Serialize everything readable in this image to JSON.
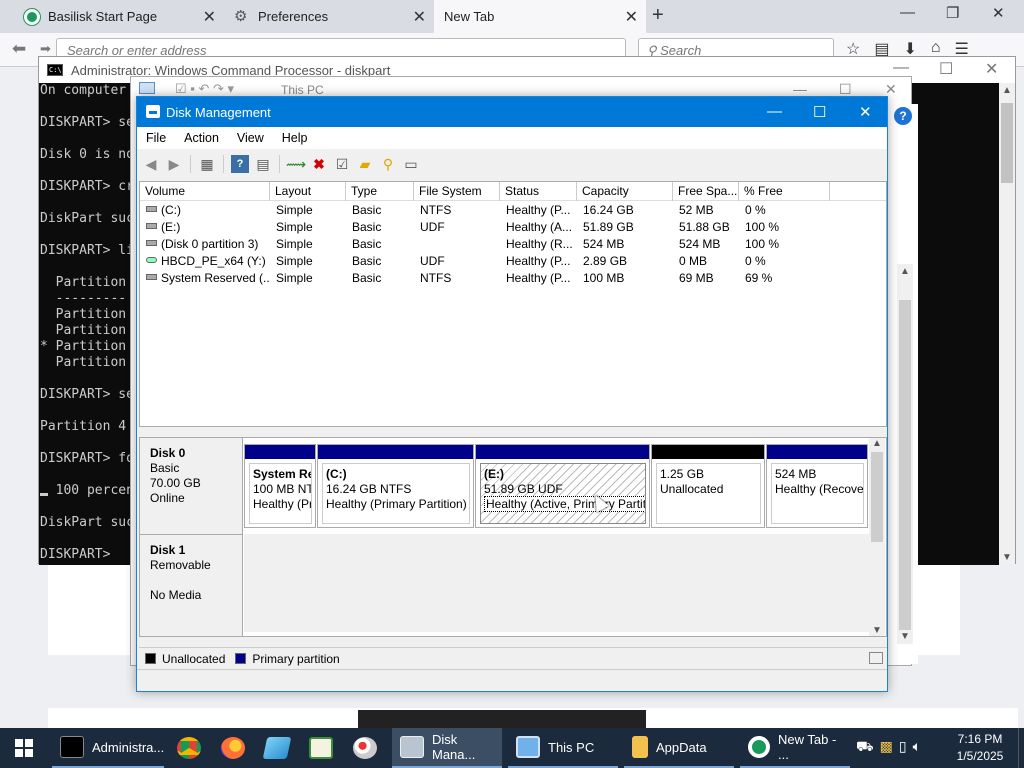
{
  "browser": {
    "tabs": [
      {
        "label": "Basilisk Start Page",
        "icon": "basilisk-icon",
        "active": false
      },
      {
        "label": "Preferences",
        "icon": "gear-icon",
        "active": false
      },
      {
        "label": "New Tab",
        "icon": "",
        "active": true
      }
    ],
    "url_placeholder": "Search or enter address",
    "search_placeholder": "Search"
  },
  "cmd": {
    "title": "Administrator: Windows Command Processor - diskpart",
    "lines": [
      "On computer",
      "",
      "DISKPART> se",
      "",
      "Disk 0 is no",
      "",
      "DISKPART> cr",
      "",
      "DiskPart suc",
      "",
      "DISKPART> li",
      "",
      "  Partition",
      "  ---------",
      "  Partition",
      "  Partition",
      "* Partition",
      "  Partition",
      "",
      "DISKPART> se",
      "",
      "Partition 4",
      "",
      "DISKPART> fo",
      "",
      "  100 percen",
      "",
      "DiskPart suc",
      "",
      "DISKPART>"
    ]
  },
  "thispc": {
    "title": "This PC"
  },
  "dm": {
    "title": "Disk Management",
    "menu": [
      "File",
      "Action",
      "View",
      "Help"
    ],
    "columns": [
      "Volume",
      "Layout",
      "Type",
      "File System",
      "Status",
      "Capacity",
      "Free Spa...",
      "% Free"
    ],
    "volumes": [
      {
        "volume": "(C:)",
        "layout": "Simple",
        "type": "Basic",
        "fs": "NTFS",
        "status": "Healthy (P...",
        "capacity": "16.24 GB",
        "free": "52 MB",
        "pct": "0 %"
      },
      {
        "volume": "(E:)",
        "layout": "Simple",
        "type": "Basic",
        "fs": "UDF",
        "status": "Healthy (A...",
        "capacity": "51.89 GB",
        "free": "51.88 GB",
        "pct": "100 %"
      },
      {
        "volume": "(Disk 0 partition 3)",
        "layout": "Simple",
        "type": "Basic",
        "fs": "",
        "status": "Healthy (R...",
        "capacity": "524 MB",
        "free": "524 MB",
        "pct": "100 %"
      },
      {
        "volume": "HBCD_PE_x64 (Y:)",
        "layout": "Simple",
        "type": "Basic",
        "fs": "UDF",
        "status": "Healthy (P...",
        "capacity": "2.89 GB",
        "free": "0 MB",
        "pct": "0 %"
      },
      {
        "volume": "System Reserved (...",
        "layout": "Simple",
        "type": "Basic",
        "fs": "NTFS",
        "status": "Healthy (P...",
        "capacity": "100 MB",
        "free": "69 MB",
        "pct": "69 %"
      }
    ],
    "disk0": {
      "name": "Disk 0",
      "type": "Basic",
      "size": "70.00 GB",
      "state": "Online"
    },
    "disk0_parts": [
      {
        "title": "System Re",
        "line1": "100 MB NT",
        "line2": "Healthy (Pr",
        "bar": "primary"
      },
      {
        "title": "(C:)",
        "line1": "16.24 GB NTFS",
        "line2": "Healthy (Primary Partition)",
        "bar": "primary"
      },
      {
        "title": "(E:)",
        "line1": "51.89 GB UDF",
        "line2": "Healthy (Active, Primary Partition)",
        "bar": "primary"
      },
      {
        "title": "",
        "line1": "1.25 GB",
        "line2": "Unallocated",
        "bar": "unallocated"
      },
      {
        "title": "",
        "line1": "524 MB",
        "line2": "Healthy (Recove",
        "bar": "primary"
      }
    ],
    "disk1": {
      "name": "Disk 1",
      "type": "Removable",
      "state": "No Media"
    },
    "legend": {
      "unallocated": "Unallocated",
      "primary": "Primary partition"
    },
    "colors": {
      "primary": "#00008b",
      "unallocated": "#000000",
      "titlebar": "#0078d7"
    }
  },
  "taskbar": {
    "items": [
      {
        "label": "Administra...",
        "icon": "cmd-icon"
      },
      {
        "label": "",
        "icon": "chrome-icon"
      },
      {
        "label": "",
        "icon": "firefox-icon"
      },
      {
        "label": "",
        "icon": "notepad-icon"
      },
      {
        "label": "",
        "icon": "spreadsheet-icon"
      },
      {
        "label": "",
        "icon": "paint-icon"
      },
      {
        "label": "Disk Mana...",
        "icon": "disk-icon"
      },
      {
        "label": "This PC",
        "icon": "computer-icon"
      },
      {
        "label": "AppData",
        "icon": "folder-icon"
      },
      {
        "label": "New Tab - ...",
        "icon": "basilisk-icon"
      }
    ],
    "time": "7:16 PM",
    "date": "1/5/2025"
  }
}
